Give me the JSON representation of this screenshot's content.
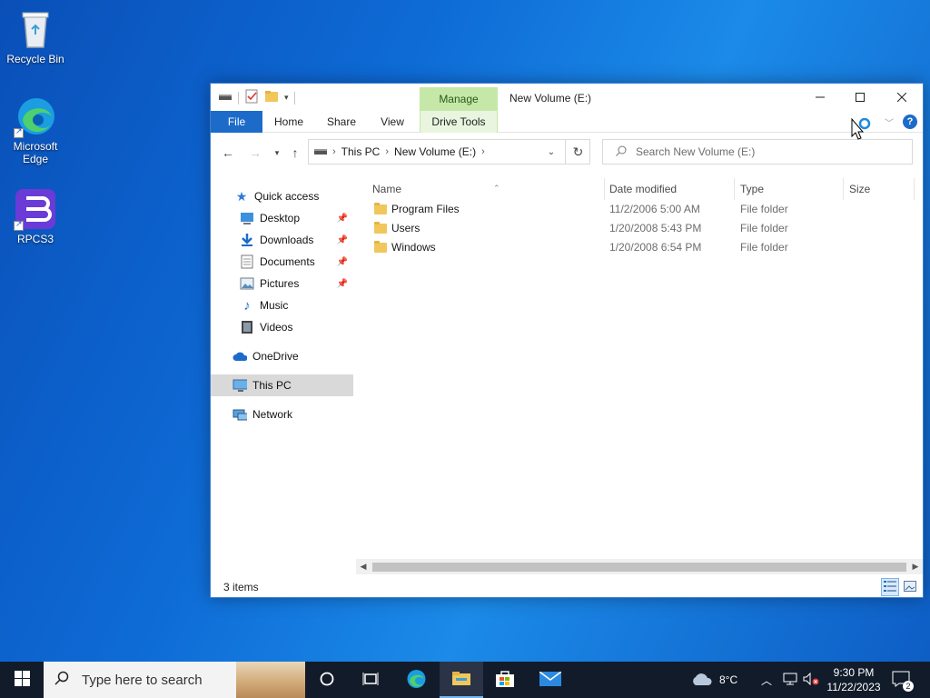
{
  "desktop": {
    "icons": [
      {
        "label": "Recycle Bin"
      },
      {
        "label": "Microsoft Edge"
      },
      {
        "label": "RPCS3"
      }
    ]
  },
  "window": {
    "title": "New Volume (E:)",
    "manage_label": "Manage",
    "drive_tools_label": "Drive Tools",
    "tabs": [
      "File",
      "Home",
      "Share",
      "View"
    ],
    "address": {
      "segments": [
        "This PC",
        "New Volume (E:)"
      ]
    },
    "search_placeholder": "Search New Volume (E:)",
    "nav": {
      "quick_access": "Quick access",
      "items": [
        {
          "label": "Desktop",
          "pinned": true
        },
        {
          "label": "Downloads",
          "pinned": true
        },
        {
          "label": "Documents",
          "pinned": true
        },
        {
          "label": "Pictures",
          "pinned": true
        },
        {
          "label": "Music",
          "pinned": false
        },
        {
          "label": "Videos",
          "pinned": false
        }
      ],
      "onedrive": "OneDrive",
      "this_pc": "This PC",
      "network": "Network"
    },
    "columns": [
      "Name",
      "Date modified",
      "Type",
      "Size"
    ],
    "files": [
      {
        "name": "Program Files",
        "date": "11/2/2006 5:00 AM",
        "type": "File folder"
      },
      {
        "name": "Users",
        "date": "1/20/2008 5:43 PM",
        "type": "File folder"
      },
      {
        "name": "Windows",
        "date": "1/20/2008 6:54 PM",
        "type": "File folder"
      }
    ],
    "status": "3 items"
  },
  "taskbar": {
    "search_placeholder": "Type here to search",
    "weather": "8°C",
    "time": "9:30 PM",
    "date": "11/22/2023",
    "notification_count": "2"
  },
  "colors": {
    "accent": "#1d6bc9",
    "manage_tab": "#c5e8a8",
    "folder": "#f1c75c",
    "taskbar": "#121b2a"
  }
}
